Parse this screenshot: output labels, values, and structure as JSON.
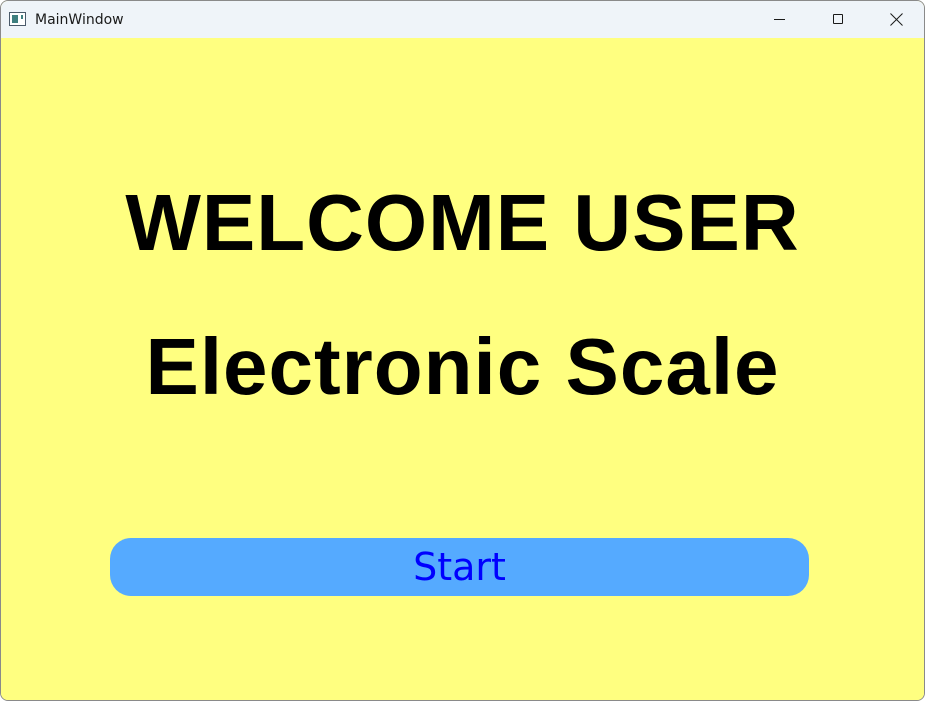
{
  "window": {
    "title": "MainWindow",
    "icon": "app-window-icon",
    "controls": {
      "minimize_icon": "minimize-icon",
      "maximize_icon": "maximize-icon",
      "close_icon": "close-icon"
    }
  },
  "main": {
    "welcome_text": "WELCOME USER",
    "app_name": "Electronic Scale",
    "start_button_label": "Start"
  },
  "colors": {
    "background": "#ffff80",
    "button_background": "#55aaff",
    "button_text": "#0000ff",
    "heading_text": "#000000"
  }
}
